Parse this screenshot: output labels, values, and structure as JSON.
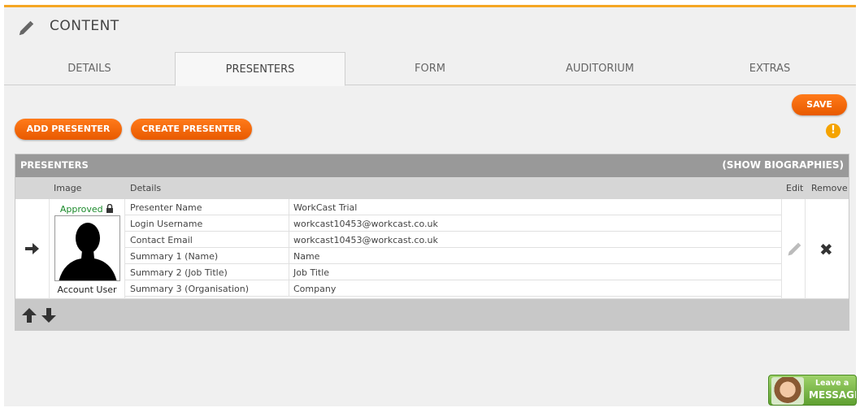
{
  "header": {
    "title": "CONTENT",
    "icon": "pencil-icon"
  },
  "tabs": [
    {
      "label": "DETAILS",
      "active": false
    },
    {
      "label": "PRESENTERS",
      "active": true
    },
    {
      "label": "FORM",
      "active": false
    },
    {
      "label": "AUDITORIUM",
      "active": false
    },
    {
      "label": "EXTRAS",
      "active": false
    }
  ],
  "actions": {
    "add_presenter": "ADD PRESENTER",
    "create_presenter": "CREATE PRESENTER",
    "save": "SAVE",
    "warning_symbol": "!"
  },
  "presenters_table": {
    "title": "PRESENTERS",
    "show_biographies": "(SHOW BIOGRAPHIES)",
    "columns": {
      "image": "Image",
      "details": "Details",
      "edit": "Edit",
      "remove": "Remove"
    },
    "rows": [
      {
        "status": "Approved",
        "role": "Account User",
        "fields": [
          {
            "label": "Presenter Name",
            "value": "WorkCast Trial"
          },
          {
            "label": "Login Username",
            "value": "workcast10453@workcast.co.uk"
          },
          {
            "label": "Contact Email",
            "value": "workcast10453@workcast.co.uk"
          },
          {
            "label": "Summary 1 (Name)",
            "value": "Name"
          },
          {
            "label": "Summary 2 (Job Title)",
            "value": "Job Title"
          },
          {
            "label": "Summary 3 (Organisation)",
            "value": "Company"
          }
        ]
      }
    ]
  },
  "leave_message": {
    "line1": "Leave a",
    "line2": "MESSAGE"
  },
  "colors": {
    "accent": "#f5a623",
    "button": "#ff6a00",
    "approved": "#1a8a2a",
    "table_header": "#999999"
  }
}
